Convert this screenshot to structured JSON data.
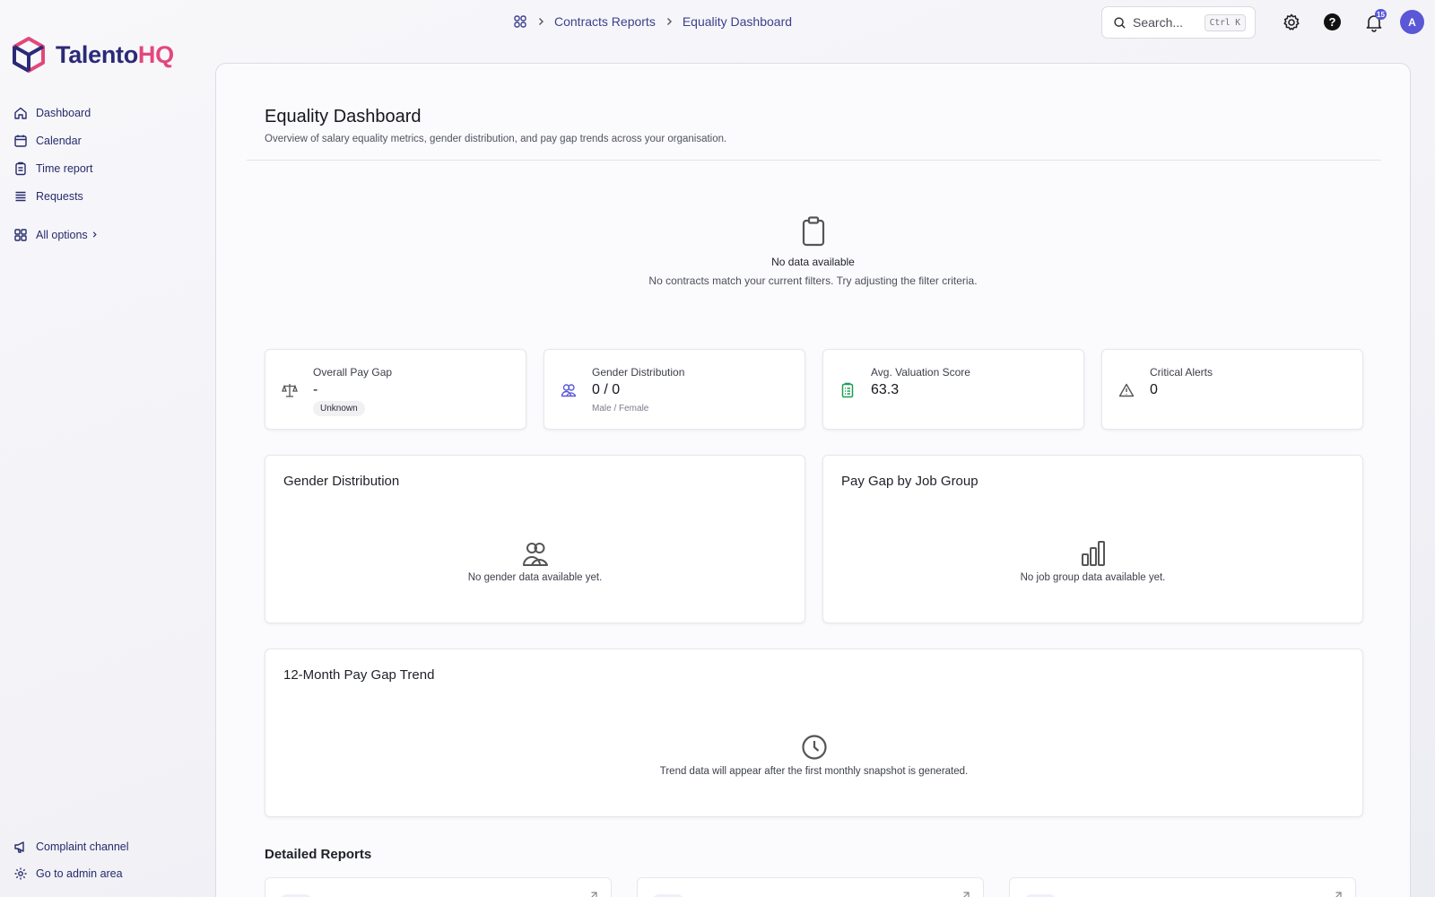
{
  "brand": {
    "name_main": "Talento",
    "name_accent": "HQ"
  },
  "sidebar": {
    "items": [
      {
        "label": "Dashboard",
        "icon": "home-icon"
      },
      {
        "label": "Calendar",
        "icon": "calendar-icon"
      },
      {
        "label": "Time report",
        "icon": "clipboard-icon"
      },
      {
        "label": "Requests",
        "icon": "list-icon"
      }
    ],
    "all_options": "All options",
    "bottom": [
      {
        "label": "Complaint channel",
        "icon": "megaphone-icon"
      },
      {
        "label": "Go to admin area",
        "icon": "gear-icon"
      }
    ]
  },
  "breadcrumb": {
    "parent": "Contracts Reports",
    "current": "Equality Dashboard"
  },
  "search": {
    "placeholder": "Search...",
    "shortcut": "Ctrl K"
  },
  "notifications": {
    "count": "15"
  },
  "user": {
    "initial": "A"
  },
  "page": {
    "title": "Equality Dashboard",
    "subtitle": "Overview of salary equality metrics, gender distribution, and pay gap trends across your organisation."
  },
  "empty_state": {
    "title": "No data available",
    "message": "No contracts match your current filters. Try adjusting the filter criteria."
  },
  "stats": {
    "pay_gap": {
      "label": "Overall Pay Gap",
      "value": "-",
      "tag": "Unknown"
    },
    "gender": {
      "label": "Gender Distribution",
      "value": "0 / 0",
      "sub": "Male / Female"
    },
    "valuation": {
      "label": "Avg. Valuation Score",
      "value": "63.3"
    },
    "alerts": {
      "label": "Critical Alerts",
      "value": "0"
    }
  },
  "panels": {
    "gender": {
      "title": "Gender Distribution",
      "empty": "No gender data available yet."
    },
    "job_group": {
      "title": "Pay Gap by Job Group",
      "empty": "No job group data available yet."
    },
    "trend": {
      "title": "12-Month Pay Gap Trend",
      "empty": "Trend data will appear after the first monthly snapshot is generated."
    }
  },
  "detailed_reports": {
    "title": "Detailed Reports"
  },
  "colors": {
    "brand_navy": "#2b2a78",
    "brand_pink": "#e4477a",
    "accent": "#5a58d6",
    "valuation_green": "#1f9d55"
  }
}
